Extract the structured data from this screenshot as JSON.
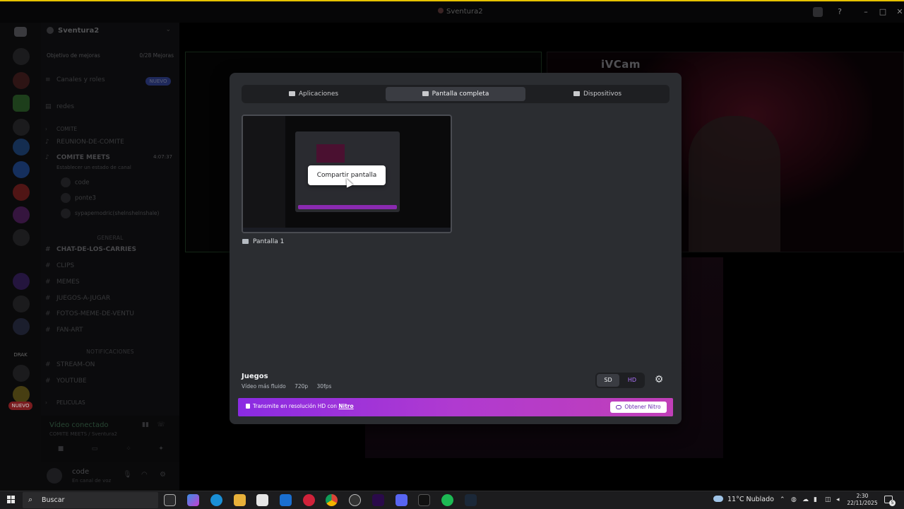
{
  "window": {
    "title": "Sventura2"
  },
  "server": {
    "name": "Sventura2",
    "boost_label": "Objetivo de mejoras",
    "boost_count": "0/28 Mejoras",
    "nuevo_badge": "NUEVO",
    "rail_label_draw": "DRAK",
    "rail_nuevo": "NUEVO"
  },
  "channels": {
    "canales_roles": "Canales y roles",
    "redes": "redes",
    "cat_comite": "COMITE",
    "reunion": "REUNION-DE-COMITE",
    "comite_meets": "COMITE MEETS",
    "comite_time": "4:07:37",
    "comite_sub": "Establecer un estado de canal",
    "vc_users": [
      "code",
      "ponte3",
      "sypapernodric(shelnshelnshale)"
    ],
    "cat_general": "GENERAL",
    "general": [
      "CHAT-DE-LOS-CARRIES",
      "CLIPS",
      "MEMES",
      "JUEGOS-A-JUGAR",
      "FOTOS-MEME-DE-VENTU",
      "FAN-ART"
    ],
    "cat_notif": "NOTIFICACIONES",
    "notif": [
      "STREAM-ON",
      "YOUTUBE"
    ],
    "cat_peliculas": "PELICULAS"
  },
  "voice": {
    "status": "Vídeo conectado",
    "sub": "COMITE MEETS / Sventura2"
  },
  "user": {
    "name": "code",
    "status": "En canal de voz"
  },
  "stage": {
    "cam_label": "iVCam"
  },
  "modal": {
    "tabs": [
      "Aplicaciones",
      "Pantalla completa",
      "Dispositivos"
    ],
    "active_tab": "Pantalla completa",
    "share_button": "Compartir pantalla",
    "screen_label": "Pantalla 1",
    "preset_title": "Juegos",
    "preset_desc": "Vídeo más fluido",
    "preset_res": "720p",
    "preset_fps": "30fps",
    "quality_sd": "SD",
    "quality_hd": "HD",
    "nitro_text": "Transmite en resolución HD con",
    "nitro_link": "Nitro",
    "nitro_button": "Obtener Nitro",
    "colors": {
      "nitro_start": "#8a2be2",
      "nitro_end": "#c13fb8",
      "hd_accent": "#b074ff"
    }
  },
  "taskbar": {
    "search_placeholder": "Buscar",
    "weather": "11°C  Nublado",
    "time": "2:30",
    "date": "22/11/2025",
    "notif_count": "5"
  }
}
